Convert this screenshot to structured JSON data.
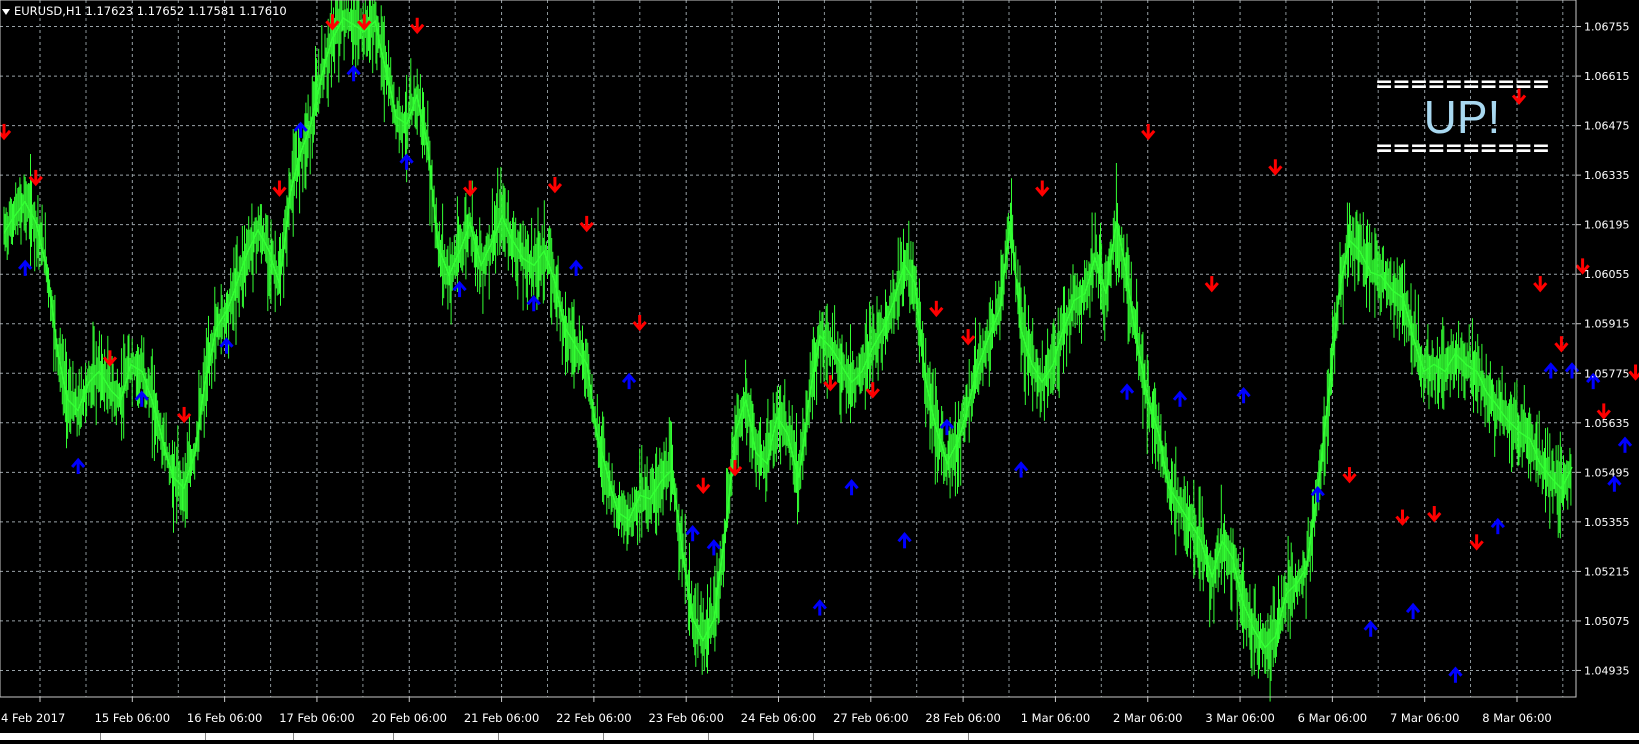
{
  "window": {
    "symbol_line": "EURUSD,H1  1.17623 1.17652 1.17581 1.17610"
  },
  "banner": {
    "rule_top": "==========",
    "text": "UP!",
    "rule_bottom": "=========="
  },
  "colors": {
    "background": "#000000",
    "grid": "#9aa3a8",
    "candles": "#33ff33",
    "up_arrow": "#0000ff",
    "down_arrow": "#ff0000",
    "banner_text": "#a8d8f0"
  },
  "icons": {
    "up_signal": "up-arrow-icon",
    "down_signal": "down-arrow-icon"
  },
  "chart_data": {
    "type": "line",
    "symbol": "EURUSD",
    "timeframe": "H1",
    "ohlc_last": {
      "open": 1.17623,
      "high": 1.17652,
      "low": 1.17581,
      "close": 1.1761
    },
    "ylim": [
      1.0486,
      1.0683
    ],
    "grid": true,
    "y_ticks": [
      "1.06755",
      "1.06615",
      "1.06475",
      "1.06335",
      "1.06195",
      "1.06055",
      "1.05915",
      "1.05775",
      "1.05635",
      "1.05495",
      "1.05355",
      "1.05215",
      "1.05075",
      "1.04935"
    ],
    "x_ticks": [
      "4 Feb 2017",
      "15 Feb 06:00",
      "16 Feb 06:00",
      "17 Feb 06:00",
      "20 Feb 06:00",
      "21 Feb 06:00",
      "22 Feb 06:00",
      "23 Feb 06:00",
      "24 Feb 06:00",
      "27 Feb 06:00",
      "28 Feb 06:00",
      "1 Mar 06:00",
      "2 Mar 06:00",
      "3 Mar 06:00",
      "6 Mar 06:00",
      "7 Mar 06:00",
      "8 Mar 06:00"
    ],
    "series": [
      {
        "values": [
          1.0617,
          1.0622,
          1.0626,
          1.062,
          1.0608,
          1.0585,
          1.057,
          1.0567,
          1.0575,
          1.0578,
          1.0573,
          1.057,
          1.058,
          1.0578,
          1.057,
          1.0558,
          1.0548,
          1.0545,
          1.0555,
          1.0575,
          1.059,
          1.0595,
          1.0603,
          1.0612,
          1.0618,
          1.0612,
          1.0603,
          1.0628,
          1.064,
          1.0648,
          1.0662,
          1.0672,
          1.0678,
          1.0676,
          1.0674,
          1.0677,
          1.0664,
          1.065,
          1.0648,
          1.0656,
          1.0641,
          1.0613,
          1.0605,
          1.0612,
          1.062,
          1.0608,
          1.0614,
          1.0622,
          1.0615,
          1.061,
          1.0608,
          1.0612,
          1.0603,
          1.059,
          1.0585,
          1.058,
          1.056,
          1.0548,
          1.0538,
          1.0536,
          1.0543,
          1.0542,
          1.0547,
          1.055,
          1.0528,
          1.0508,
          1.0502,
          1.0508,
          1.053,
          1.056,
          1.057,
          1.0555,
          1.0552,
          1.0565,
          1.056,
          1.0548,
          1.057,
          1.0588,
          1.0585,
          1.058,
          1.0575,
          1.0578,
          1.0585,
          1.059,
          1.0598,
          1.0608,
          1.0603,
          1.0575,
          1.0562,
          1.0552,
          1.0558,
          1.0568,
          1.058,
          1.0588,
          1.0596,
          1.062,
          1.059,
          1.058,
          1.0575,
          1.058,
          1.059,
          1.0598,
          1.06,
          1.061,
          1.06,
          1.062,
          1.0605,
          1.0585,
          1.057,
          1.056,
          1.0545,
          1.054,
          1.0535,
          1.053,
          1.052,
          1.053,
          1.0525,
          1.0512,
          1.0505,
          1.05,
          1.0503,
          1.0515,
          1.0518,
          1.0523,
          1.0545,
          1.057,
          1.06,
          1.0615,
          1.0612,
          1.0606,
          1.0605,
          1.0601,
          1.0599,
          1.0588,
          1.0578,
          1.058,
          1.0578,
          1.0583,
          1.058,
          1.0578,
          1.0572,
          1.0568,
          1.0564,
          1.0561,
          1.0559,
          1.0552,
          1.0548,
          1.0545,
          1.0551
        ]
      }
    ],
    "signals": [
      {
        "dir": "down",
        "i": 0,
        "price": 1.0646
      },
      {
        "dir": "down",
        "i": 3,
        "price": 1.0633
      },
      {
        "dir": "up",
        "i": 2,
        "price": 1.0607
      },
      {
        "dir": "down",
        "i": 10,
        "price": 1.0582
      },
      {
        "dir": "up",
        "i": 7,
        "price": 1.0551
      },
      {
        "dir": "up",
        "i": 13,
        "price": 1.057
      },
      {
        "dir": "down",
        "i": 17,
        "price": 1.0566
      },
      {
        "dir": "up",
        "i": 21,
        "price": 1.0585
      },
      {
        "dir": "down",
        "i": 26,
        "price": 1.063
      },
      {
        "dir": "up",
        "i": 28,
        "price": 1.0646
      },
      {
        "dir": "down",
        "i": 31,
        "price": 1.0677
      },
      {
        "dir": "down",
        "i": 34,
        "price": 1.0677
      },
      {
        "dir": "up",
        "i": 33,
        "price": 1.0662
      },
      {
        "dir": "down",
        "i": 39,
        "price": 1.0676
      },
      {
        "dir": "up",
        "i": 38,
        "price": 1.0637
      },
      {
        "dir": "down",
        "i": 44,
        "price": 1.063
      },
      {
        "dir": "up",
        "i": 43,
        "price": 1.0601
      },
      {
        "dir": "down",
        "i": 52,
        "price": 1.0631
      },
      {
        "dir": "up",
        "i": 50,
        "price": 1.0597
      },
      {
        "dir": "down",
        "i": 55,
        "price": 1.062
      },
      {
        "dir": "up",
        "i": 54,
        "price": 1.0607
      },
      {
        "dir": "down",
        "i": 60,
        "price": 1.0592
      },
      {
        "dir": "up",
        "i": 59,
        "price": 1.0575
      },
      {
        "dir": "down",
        "i": 66,
        "price": 1.0546
      },
      {
        "dir": "up",
        "i": 65,
        "price": 1.0532
      },
      {
        "dir": "up",
        "i": 67,
        "price": 1.0528
      },
      {
        "dir": "down",
        "i": 69,
        "price": 1.0551
      },
      {
        "dir": "up",
        "i": 77,
        "price": 1.0511
      },
      {
        "dir": "down",
        "i": 78,
        "price": 1.0575
      },
      {
        "dir": "down",
        "i": 82,
        "price": 1.0573
      },
      {
        "dir": "up",
        "i": 80,
        "price": 1.0545
      },
      {
        "dir": "up",
        "i": 85,
        "price": 1.053
      },
      {
        "dir": "down",
        "i": 88,
        "price": 1.0596
      },
      {
        "dir": "down",
        "i": 91,
        "price": 1.0588
      },
      {
        "dir": "up",
        "i": 89,
        "price": 1.0562
      },
      {
        "dir": "up",
        "i": 96,
        "price": 1.055
      },
      {
        "dir": "down",
        "i": 98,
        "price": 1.063
      },
      {
        "dir": "up",
        "i": 106,
        "price": 1.0572
      },
      {
        "dir": "down",
        "i": 108,
        "price": 1.0646
      },
      {
        "dir": "up",
        "i": 111,
        "price": 1.057
      },
      {
        "dir": "down",
        "i": 114,
        "price": 1.0603
      },
      {
        "dir": "up",
        "i": 117,
        "price": 1.0571
      },
      {
        "dir": "down",
        "i": 120,
        "price": 1.0636
      },
      {
        "dir": "up",
        "i": 124,
        "price": 1.0543
      },
      {
        "dir": "down",
        "i": 127,
        "price": 1.0549
      },
      {
        "dir": "up",
        "i": 129,
        "price": 1.0505
      },
      {
        "dir": "down",
        "i": 132,
        "price": 1.0537
      },
      {
        "dir": "up",
        "i": 133,
        "price": 1.051
      },
      {
        "dir": "down",
        "i": 135,
        "price": 1.0538
      },
      {
        "dir": "up",
        "i": 137,
        "price": 1.0492
      },
      {
        "dir": "down",
        "i": 139,
        "price": 1.053
      },
      {
        "dir": "up",
        "i": 141,
        "price": 1.0534
      },
      {
        "dir": "down",
        "i": 143,
        "price": 1.0656
      },
      {
        "dir": "down",
        "i": 145,
        "price": 1.0603
      },
      {
        "dir": "up",
        "i": 146,
        "price": 1.0578
      },
      {
        "dir": "down",
        "i": 147,
        "price": 1.0586
      },
      {
        "dir": "up",
        "i": 148,
        "price": 1.0578
      },
      {
        "dir": "down",
        "i": 149,
        "price": 1.0608
      },
      {
        "dir": "up",
        "i": 150,
        "price": 1.0575
      },
      {
        "dir": "down",
        "i": 151,
        "price": 1.0567
      },
      {
        "dir": "up",
        "i": 152,
        "price": 1.0546
      },
      {
        "dir": "up",
        "i": 153,
        "price": 1.0557
      },
      {
        "dir": "down",
        "i": 154,
        "price": 1.0578
      },
      {
        "dir": "up",
        "i": 155,
        "price": 1.054
      }
    ]
  }
}
